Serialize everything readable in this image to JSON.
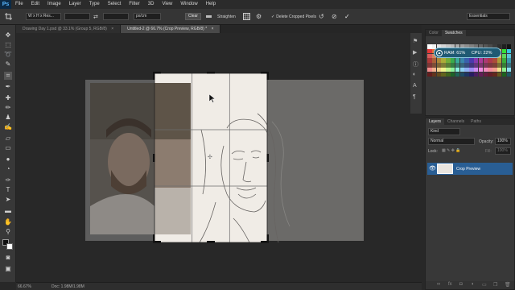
{
  "app": {
    "logo": "Ps"
  },
  "menu": [
    "File",
    "Edit",
    "Image",
    "Layer",
    "Type",
    "Select",
    "Filter",
    "3D",
    "View",
    "Window",
    "Help"
  ],
  "options": {
    "ratio_value": "W x H x Res...",
    "units_value": "px/cm",
    "clear_label": "Clear",
    "straighten_label": "Straighten",
    "delete_cropped_label": "Delete Cropped Pixels",
    "workspace_value": "Essentials"
  },
  "tabs": [
    {
      "label": "Drawing Day 1.psd @ 33.1% (Group 5, RGB/8)",
      "active": false
    },
    {
      "label": "Untitled-2 @ 66.7% (Crop Preview, RGB/8) *",
      "active": true
    }
  ],
  "status": {
    "zoom": "66.67%",
    "doc": "Doc: 1.98M/1.98M"
  },
  "color_panel": {
    "tabs": [
      "Color",
      "Swatches"
    ],
    "ram_label": "RAM: 61%",
    "cpu_label": "CPU: 22%"
  },
  "layers_panel": {
    "tabs": [
      "Layers",
      "Channels",
      "Paths"
    ],
    "kind_label": "Kind",
    "blend_mode": "Normal",
    "opacity_label": "Opacity:",
    "opacity_value": "100%",
    "lock_label": "Lock:",
    "fill_label": "Fill:",
    "fill_value": "100%",
    "layer_name": "Crop Preview"
  },
  "icons": {
    "tools": [
      "move-tool-icon",
      "marquee-tool-icon",
      "lasso-tool-icon",
      "quick-select-icon",
      "crop-tool-icon",
      "eyedropper-icon",
      "healing-brush-icon",
      "brush-icon",
      "clone-stamp-icon",
      "history-brush-icon",
      "eraser-icon",
      "gradient-icon",
      "blur-icon",
      "dodge-icon",
      "pen-icon",
      "type-icon",
      "path-select-icon",
      "shape-icon",
      "hand-icon",
      "zoom-icon"
    ]
  }
}
